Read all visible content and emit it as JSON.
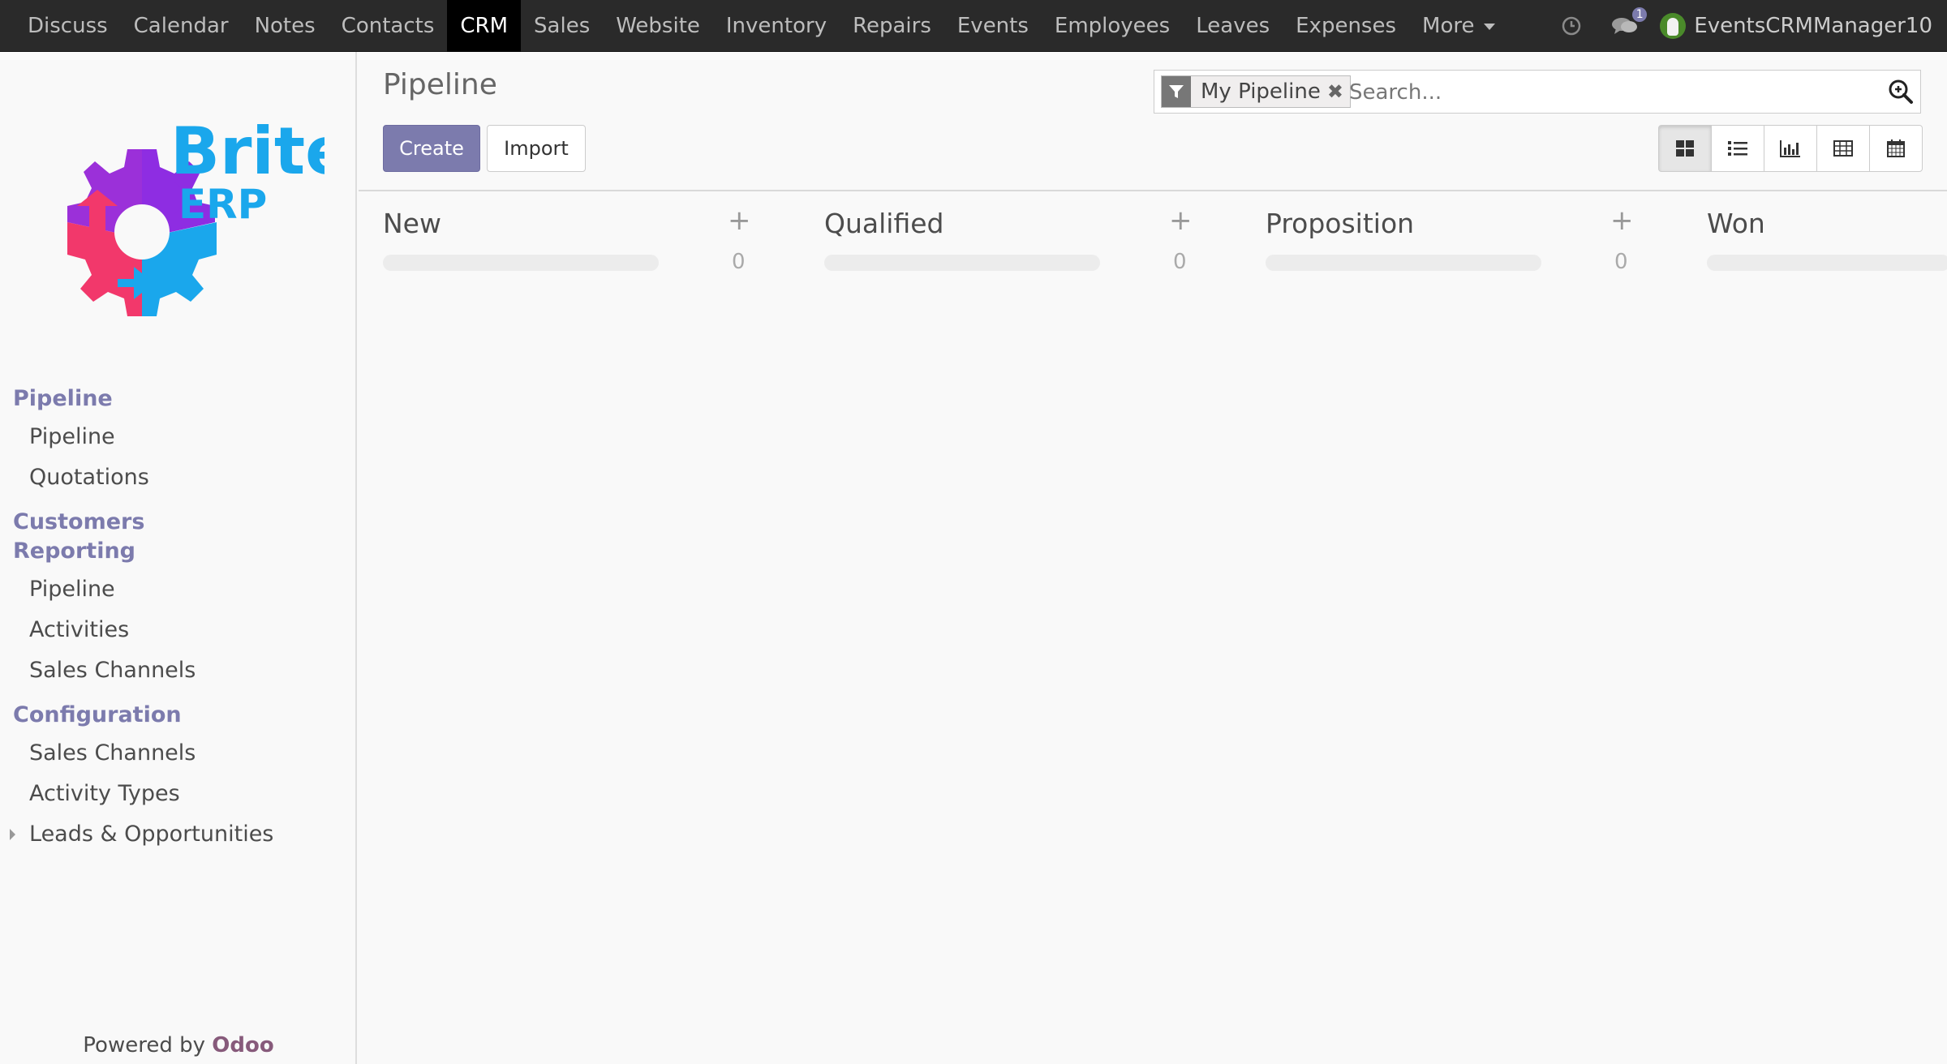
{
  "topbar": {
    "menu": [
      "Discuss",
      "Calendar",
      "Notes",
      "Contacts",
      "CRM",
      "Sales",
      "Website",
      "Inventory",
      "Repairs",
      "Events",
      "Employees",
      "Leaves",
      "Expenses"
    ],
    "more_label": "More",
    "active": "CRM",
    "messages_count": "1",
    "user_name": "EventsCRMManager10",
    "icons": [
      "clock-icon",
      "chat-icon",
      "avatar"
    ]
  },
  "sidebar": {
    "logo": {
      "brand_word": "Brite",
      "brand_sub": "ERP",
      "colors": {
        "purple": "#8e2de2",
        "pink": "#f2386b",
        "blue": "#1aa7ec"
      }
    },
    "sections": [
      {
        "title": "Pipeline",
        "items": [
          "Pipeline",
          "Quotations"
        ]
      },
      {
        "title": "Customers",
        "items": []
      },
      {
        "title": "Reporting",
        "items": [
          "Pipeline",
          "Activities",
          "Sales Channels"
        ]
      },
      {
        "title": "Configuration",
        "items": [
          "Sales Channels",
          "Activity Types",
          "Leads & Opportunities"
        ]
      }
    ],
    "powered_prefix": "Powered by",
    "powered_brand": "Odoo"
  },
  "control": {
    "breadcrumb": "Pipeline",
    "create_label": "Create",
    "import_label": "Import",
    "search": {
      "facet_label": "My Pipeline",
      "facet_close": "✖",
      "placeholder": "Search..."
    },
    "views": [
      "kanban",
      "list",
      "graph",
      "pivot",
      "calendar"
    ],
    "active_view": "kanban"
  },
  "kanban": {
    "columns": [
      {
        "title": "New",
        "count": "0"
      },
      {
        "title": "Qualified",
        "count": "0"
      },
      {
        "title": "Proposition",
        "count": "0"
      },
      {
        "title": "Won",
        "count": ""
      }
    ],
    "add_symbol": "+"
  },
  "colors": {
    "accent": "#7c7bad",
    "navbar": "#2a2a2a",
    "odoo": "#875a7b"
  }
}
